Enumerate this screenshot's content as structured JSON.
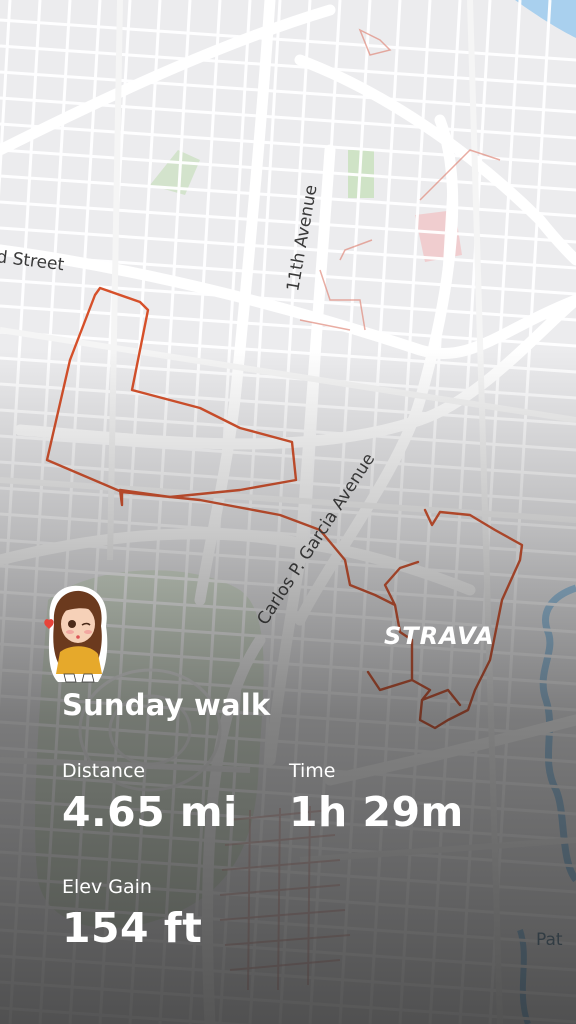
{
  "map": {
    "street_labels": {
      "second_street": "d Street",
      "eleventh_avenue": "11th Avenue",
      "garcia_avenue_upper": "Carlos P. Garcia Avenue",
      "garcia_avenue_lower": "Carlos P. Garcia Avenue",
      "park_partial": "Pat"
    },
    "route_color": "#d6502a",
    "park_color": "#8fb87a",
    "water_color": "#9cc7e6"
  },
  "brand": {
    "name": "STRAVA"
  },
  "activity": {
    "title": "Sunday walk",
    "distance": {
      "label": "Distance",
      "value": "4.65 mi"
    },
    "time": {
      "label": "Time",
      "value": "1h 29m"
    },
    "elev_gain": {
      "label": "Elev Gain",
      "value": "154 ft"
    }
  },
  "avatar": {
    "icon": "sticker-girl-kiss-icon"
  }
}
